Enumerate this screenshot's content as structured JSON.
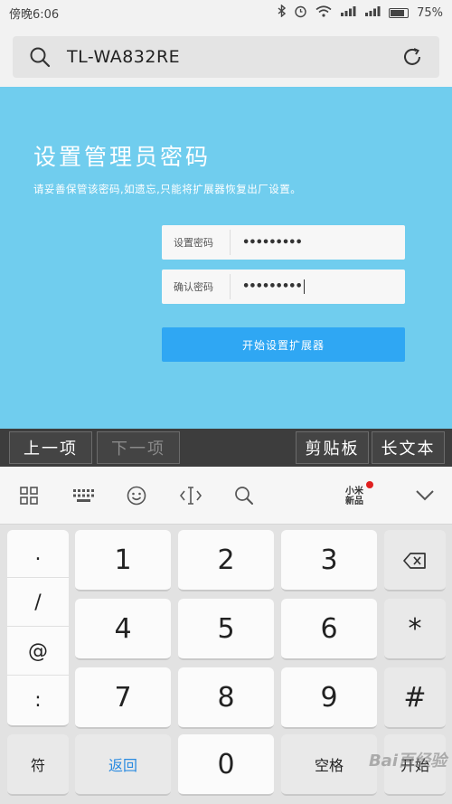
{
  "status_bar": {
    "time": "傍晚6:06",
    "battery_percent": "75%",
    "battery_level": 0.75
  },
  "url_bar": {
    "url": "TL-WA832RE"
  },
  "page": {
    "title": "设置管理员密码",
    "description": "请妥善保管该密码,如遗忘,只能将扩展器恢复出厂设置。",
    "fields": [
      {
        "label": "设置密码",
        "value": "•••••••••"
      },
      {
        "label": "确认密码",
        "value": "•••••••••"
      }
    ],
    "submit_label": "开始设置扩展器"
  },
  "toolbar": {
    "prev": "上一项",
    "next": "下一项",
    "clipboard": "剪贴板",
    "long_text": "长文本"
  },
  "keyboard_icons": {
    "mi_new": "小米新品",
    "icons": [
      "grid-icon",
      "keyboard-icon",
      "emoji-icon",
      "cursor-icon",
      "search-icon",
      "chevron-down-icon"
    ]
  },
  "keyboard": {
    "symbols": [
      ".",
      "/",
      "@",
      ":"
    ],
    "rows": [
      [
        "1",
        "2",
        "3"
      ],
      [
        "4",
        "5",
        "6"
      ],
      [
        "7",
        "8",
        "9"
      ]
    ],
    "backspace": "⌫",
    "star": "*",
    "hash": "#",
    "symbol_key": "符",
    "return_key": "返回",
    "zero": "0",
    "space_key": "空格",
    "start_key": "开始"
  },
  "watermark": "Bai百经验"
}
